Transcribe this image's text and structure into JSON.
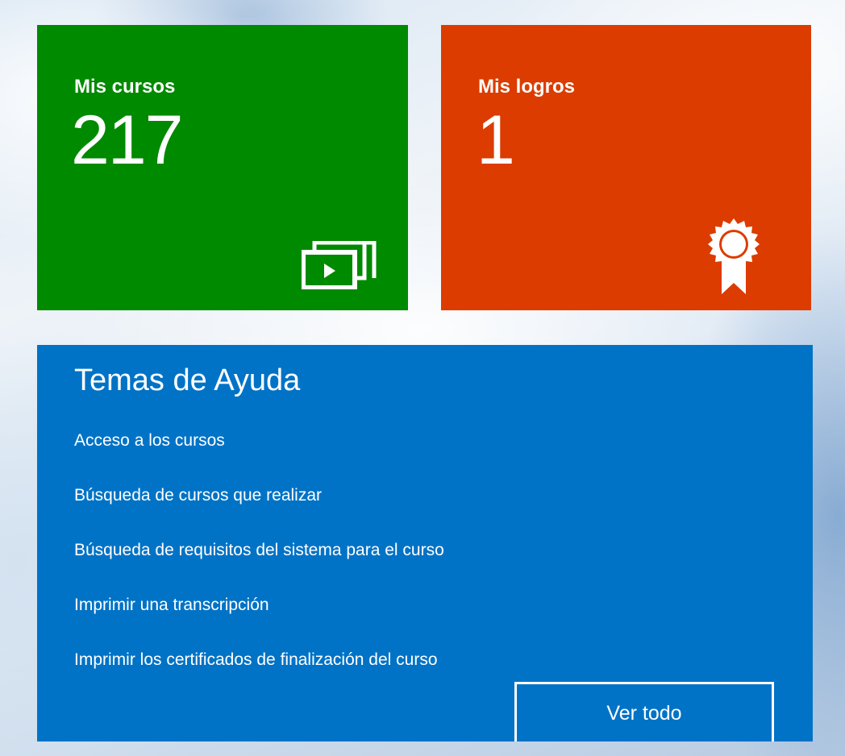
{
  "tiles": {
    "courses": {
      "title": "Mis cursos",
      "count": "217",
      "icon": "video-playlist-icon",
      "color": "#008a00"
    },
    "achievements": {
      "title": "Mis logros",
      "count": "1",
      "icon": "award-ribbon-icon",
      "color": "#dc3c00"
    }
  },
  "help": {
    "title": "Temas de Ayuda",
    "color": "#0073c6",
    "links": [
      "Acceso a los cursos",
      "Búsqueda de cursos que realizar",
      "Búsqueda de requisitos del sistema para el curso",
      "Imprimir una transcripción",
      "Imprimir los certificados de finalización del curso"
    ],
    "view_all_label": "Ver todo"
  }
}
